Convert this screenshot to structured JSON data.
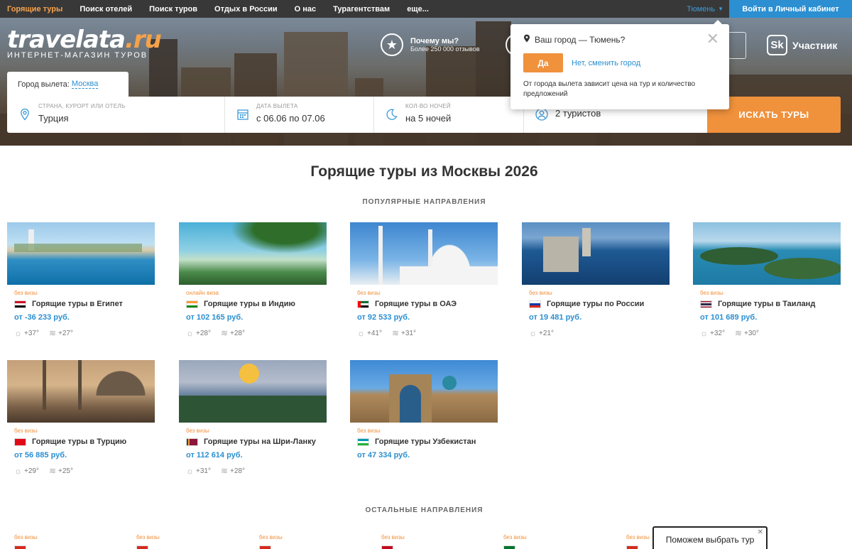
{
  "topnav": {
    "items": [
      "Горящие туры",
      "Поиск отелей",
      "Поиск туров",
      "Отдых в России",
      "О нас",
      "Турагентствам",
      "еще..."
    ],
    "city": "Тюмень",
    "login": "Войти в Личный кабинет"
  },
  "hero": {
    "logo_main": "travelata",
    "logo_ru": ".ru",
    "tagline": "ИНТЕРНЕТ-МАГАЗИН ТУРОВ",
    "why_title": "Почему мы?",
    "why_sub": "Более 250 000 отзывов",
    "sk_label": "Участник",
    "sk_badge": "Sk"
  },
  "search": {
    "departure_prefix": "Город вылета:",
    "departure_city": "Москва",
    "fields": [
      {
        "label": "СТРАНА, КУРОРТ ИЛИ ОТЕЛЬ",
        "value": "Турция",
        "icon": "location-pin-icon"
      },
      {
        "label": "ДАТА ВЫЛЕТА",
        "value": "с 06.06 по 07.06",
        "icon": "calendar-icon"
      },
      {
        "label": "КОЛ-ВО НОЧЕЙ",
        "value": "на 5 ночей",
        "icon": "moon-icon"
      },
      {
        "label": "",
        "value": "2 туристов",
        "icon": "user-icon"
      }
    ],
    "button": "ИСКАТЬ ТУРЫ"
  },
  "popup": {
    "question": "Ваш город — Тюмень?",
    "yes": "Да",
    "no": "Нет, сменить город",
    "note": "От города вылета зависит цена на тур и количество предложений"
  },
  "main": {
    "title": "Горящие туры из Москвы 2026",
    "popular_label": "ПОПУЛЯРНЫЕ НАПРАВЛЕНИЯ",
    "other_label": "ОСТАЛЬНЫЕ НАПРАВЛЕНИЯ"
  },
  "cards": [
    {
      "visa": "без визы",
      "title": "Горящие туры в Египет",
      "price": "от -36 233 руб.",
      "air": "+37°",
      "water": "+27°"
    },
    {
      "visa": "онлайн виза",
      "title": "Горящие туры в Индию",
      "price": "от 102 165 руб.",
      "air": "+28°",
      "water": "+28°"
    },
    {
      "visa": "без визы",
      "title": "Горящие туры в ОАЭ",
      "price": "от 92 533 руб.",
      "air": "+41°",
      "water": "+31°"
    },
    {
      "visa": "без визы",
      "title": "Горящие туры по России",
      "price": "от 19 481 руб.",
      "air": "+21°",
      "water": ""
    },
    {
      "visa": "без визы",
      "title": "Горящие туры в Таиланд",
      "price": "от 101 689 руб.",
      "air": "+32°",
      "water": "+30°"
    },
    {
      "visa": "без визы",
      "title": "Горящие туры в Турцию",
      "price": "от 56 885 руб.",
      "air": "+29°",
      "water": "+25°"
    },
    {
      "visa": "без визы",
      "title": "Горящие туры на Шри-Ланку",
      "price": "от 112 614 руб.",
      "air": "+31°",
      "water": "+28°"
    },
    {
      "visa": "без визы",
      "title": "Горящие туры Узбекистан",
      "price": "от 47 334 руб.",
      "air": "",
      "water": ""
    }
  ],
  "bottom": {
    "visa_labels": [
      "без визы",
      "без визы",
      "без визы",
      "без визы",
      "без визы",
      "без визы"
    ],
    "help": "Поможем выбрать тур"
  },
  "colors": {
    "accent": "#f0913c",
    "link": "#2b8fd1",
    "nav_bg": "#383838"
  }
}
